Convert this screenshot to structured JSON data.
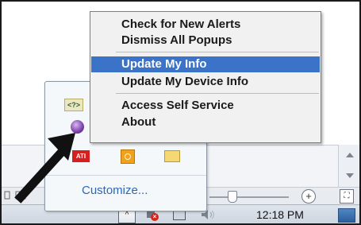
{
  "context_menu": {
    "items": [
      {
        "label": "Check for New Alerts",
        "selected": false
      },
      {
        "label": "Dismiss All Popups",
        "selected": false
      },
      {
        "label": "Update My Info",
        "selected": true
      },
      {
        "label": "Update My Device Info",
        "selected": false
      },
      {
        "label": "Access Self Service",
        "selected": false
      },
      {
        "label": "About",
        "selected": false
      }
    ]
  },
  "tray_overflow": {
    "customize_label": "Customize...",
    "icons": [
      "user-agent-icon",
      "purple-ball-icon",
      "gray-ring-icon",
      "green-icon",
      "ati-icon",
      "orange-icon",
      "mail-icon"
    ],
    "ati_text": "ATI",
    "user_agent_text": "<?>"
  },
  "taskbar": {
    "clock": "12:18 PM",
    "show_hidden_glyph": "^",
    "icons": [
      "show-hidden-icons-button",
      "action-center-flag-icon",
      "network-icon",
      "volume-icon",
      "show-desktop-button"
    ]
  },
  "statusbar": {
    "zoom_plus_glyph": "+",
    "fit_glyph": "⛶"
  },
  "colors": {
    "menu_highlight": "#3b73c9",
    "link": "#2b68b5",
    "arrow": "#111111"
  }
}
